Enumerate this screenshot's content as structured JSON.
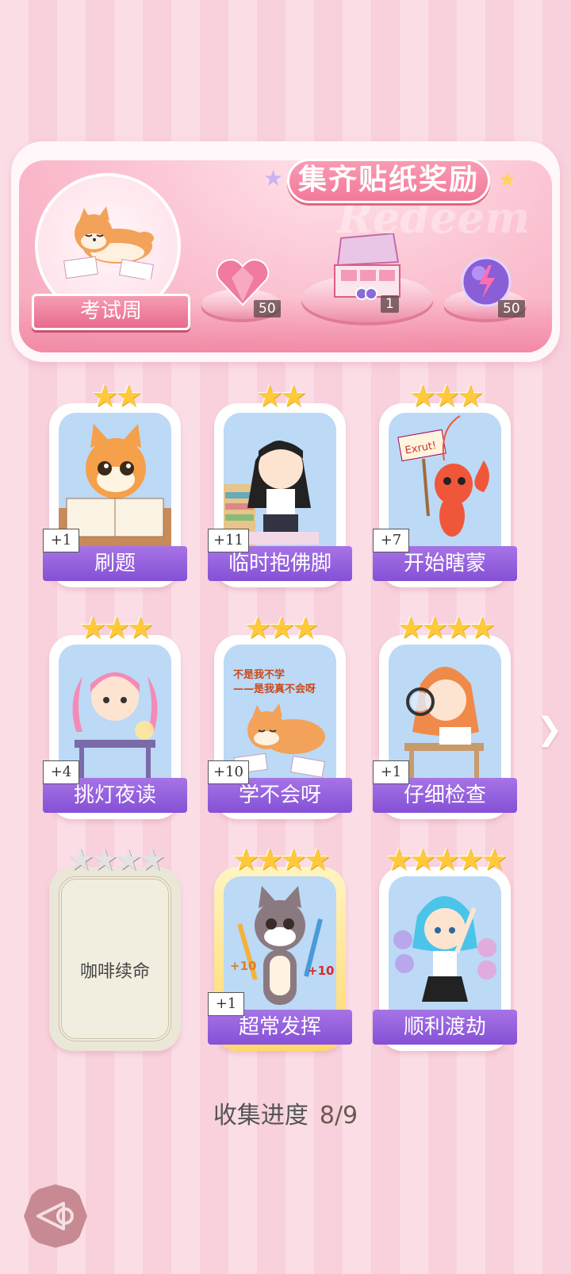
{
  "banner": {
    "title": "集齐贴纸奖励",
    "watermark": "Redeem",
    "theme_label": "考试周",
    "rewards": [
      {
        "name": "pink-heart-gem",
        "count": "50"
      },
      {
        "name": "gift-box",
        "count": "1"
      },
      {
        "name": "purple-energy-orb",
        "count": "50"
      }
    ]
  },
  "cards": [
    {
      "label": "刷题",
      "badge": "+1",
      "stars": "★★",
      "collected": true
    },
    {
      "label": "临时抱佛脚",
      "badge": "+11",
      "stars": "★★",
      "collected": true
    },
    {
      "label": "开始瞎蒙",
      "badge": "+7",
      "stars": "★★★",
      "collected": true,
      "sign": "Exrut!"
    },
    {
      "label": "挑灯夜读",
      "badge": "+4",
      "stars": "★★★",
      "collected": true
    },
    {
      "label": "学不会呀",
      "badge": "+10",
      "stars": "★★★",
      "collected": true,
      "caption_line1": "不是我不学",
      "caption_line2": "——是我真不会呀"
    },
    {
      "label": "仔细检查",
      "badge": "+1",
      "stars": "★★★★",
      "collected": true
    },
    {
      "label": "咖啡续命",
      "badge": "",
      "stars": "★★★★",
      "collected": false
    },
    {
      "label": "超常发挥",
      "badge": "+1",
      "stars": "★★★★",
      "collected": true,
      "bonus": "+10"
    },
    {
      "label": "顺利渡劫",
      "badge": "",
      "stars": "★★★★★",
      "collected": true
    }
  ],
  "progress": {
    "label": "收集进度",
    "value": "8/9"
  },
  "colors": {
    "accent_purple": "#8550d6",
    "star_gold": "#ffc93a",
    "banner_pink": "#f27999"
  }
}
